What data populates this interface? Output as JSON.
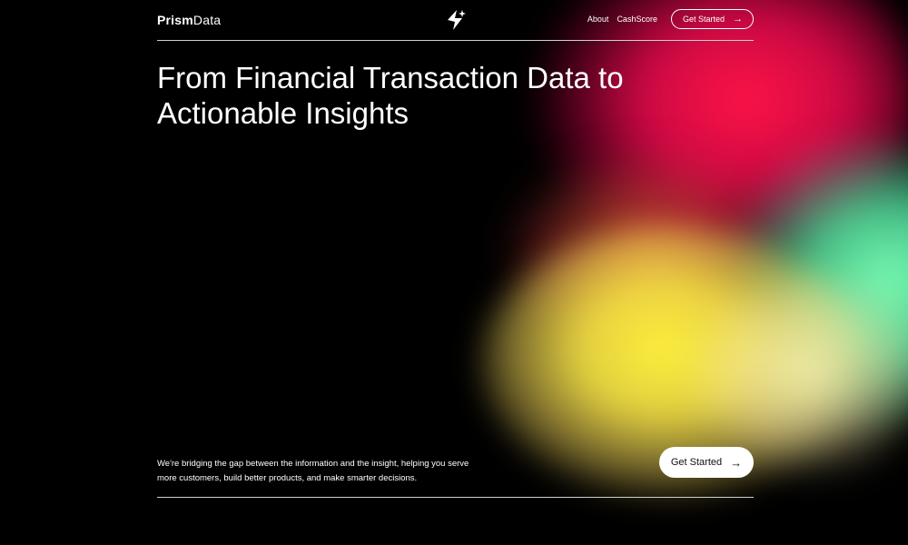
{
  "header": {
    "logo_bold": "Prism",
    "logo_light": "Data",
    "center_icon": "sparkle-icon",
    "nav": [
      {
        "label": "About"
      },
      {
        "label": "CashScore"
      }
    ],
    "cta_label": "Get Started",
    "cta_icon": "arrow-right-icon"
  },
  "hero": {
    "headline": "From Financial Transaction Data to Actionable Insights",
    "tagline": "We're bridging the gap between the information and the insight, helping you serve more customers, build better products, and make smarter decisions.",
    "cta_label": "Get Started",
    "cta_icon": "arrow-right-icon"
  },
  "colors": {
    "background": "#000000",
    "text": "#ffffff",
    "gradient": [
      "#ff1446",
      "#ffef3c",
      "#78ffb4",
      "#fffab4"
    ]
  }
}
